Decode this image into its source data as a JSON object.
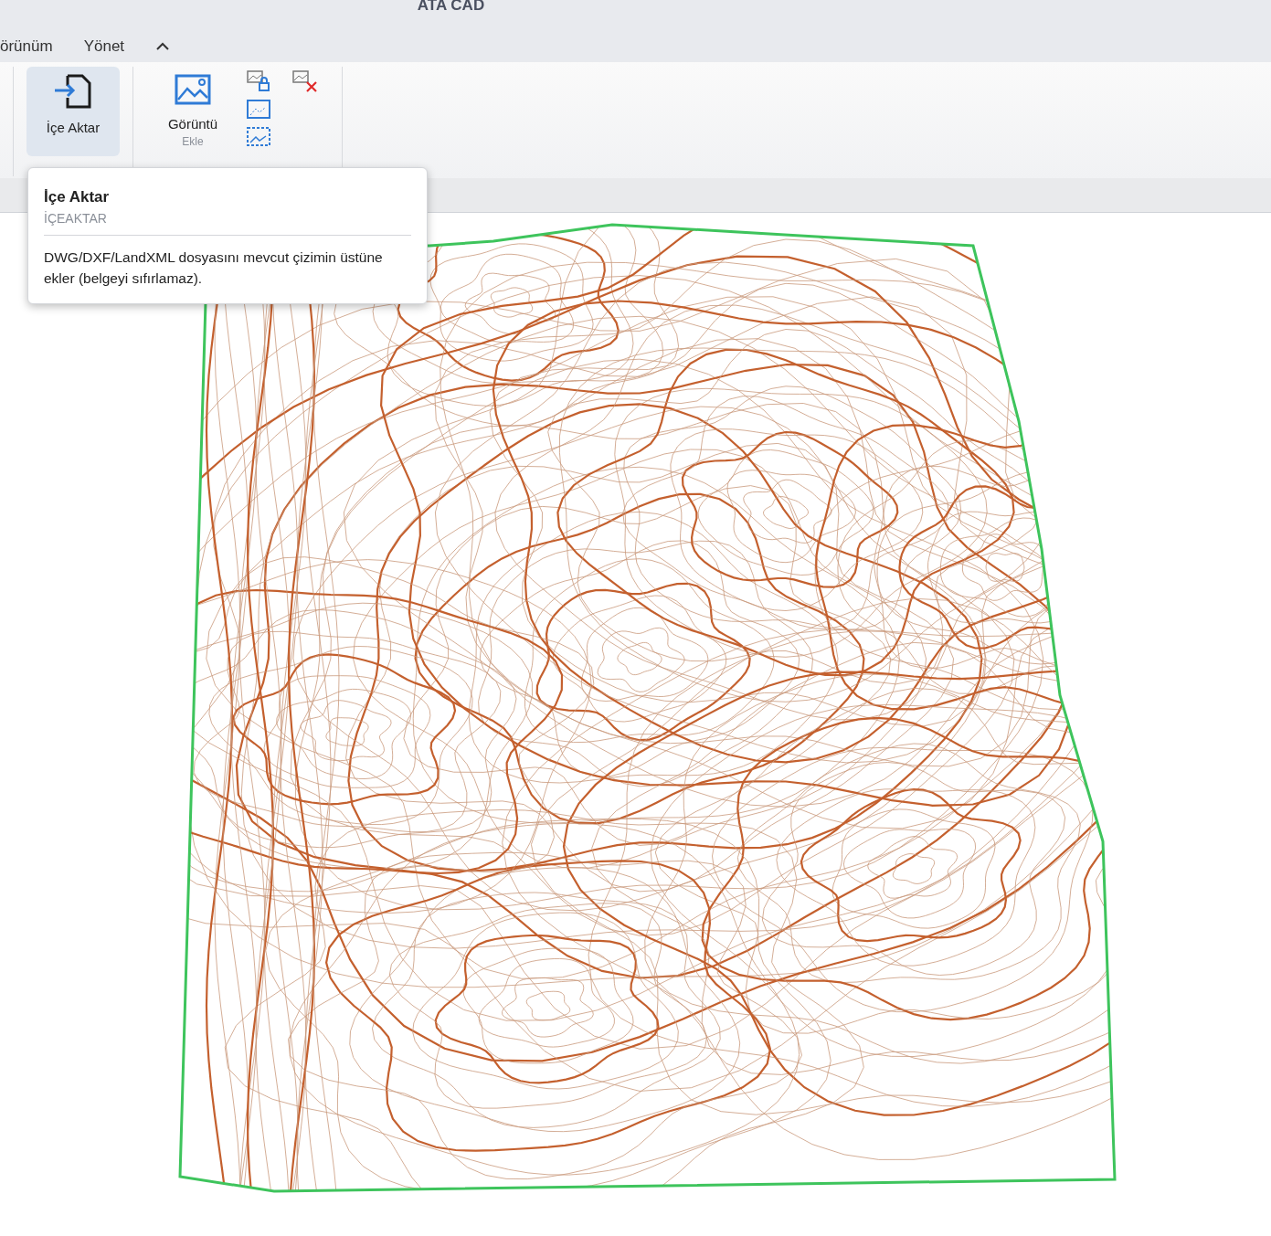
{
  "window": {
    "title": "ATA CAD"
  },
  "tabs": [
    {
      "label": "örünüm",
      "selected": false
    },
    {
      "label": "Yönet",
      "selected": false
    }
  ],
  "ribbon": {
    "buttons": [
      {
        "kind": "import",
        "label": "İçe Aktar",
        "highlighted": true
      },
      {
        "kind": "image",
        "label": "Görüntü",
        "sublabel": "Ekle",
        "highlighted": false
      }
    ]
  },
  "tooltip": {
    "title": "İçe Aktar",
    "command": "İÇEAKTAR",
    "description": "DWG/DXF/LandXML dosyasını mevcut çizimin üstüne ekler (belgeyi sıfırlamaz)."
  }
}
